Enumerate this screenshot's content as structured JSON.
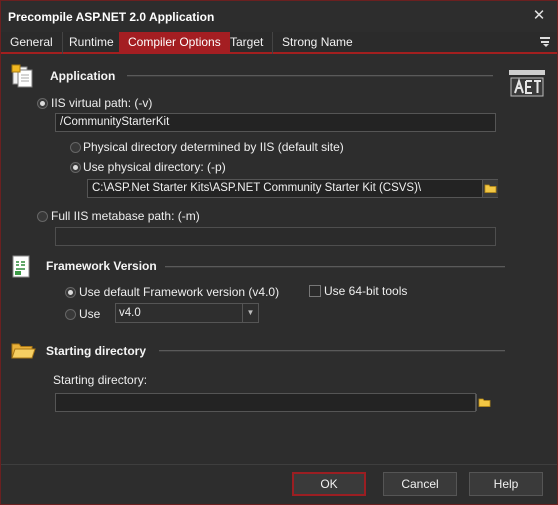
{
  "window": {
    "title": "Precompile ASP.NET 2.0 Application"
  },
  "tabs": [
    {
      "label": "General"
    },
    {
      "label": "Runtime"
    },
    {
      "label": "Compiler Options"
    },
    {
      "label": "Target"
    },
    {
      "label": "Strong Name"
    }
  ],
  "application": {
    "title": "Application",
    "iis_virtual_path_label": "IIS virtual path: (-v)",
    "iis_virtual_path_value": "/CommunityStarterKit",
    "physical_auto_label": "Physical directory determined by IIS (default site)",
    "physical_use_label": "Use physical directory: (-p)",
    "physical_path_value": "C:\\ASP.Net Starter Kits\\ASP.NET Community Starter Kit (CSVS)\\",
    "metabase_label": "Full IIS metabase path: (-m)",
    "metabase_value": ""
  },
  "framework": {
    "title": "Framework Version",
    "default_label": "Use default Framework version (v4.0)",
    "use_label": "Use",
    "version_value": "v4.0",
    "use64_label": "Use 64-bit tools"
  },
  "starting": {
    "title": "Starting directory",
    "field_label": "Starting directory:",
    "value": ""
  },
  "footer": {
    "ok_label": "OK",
    "cancel_label": "Cancel",
    "help_label": "Help"
  }
}
